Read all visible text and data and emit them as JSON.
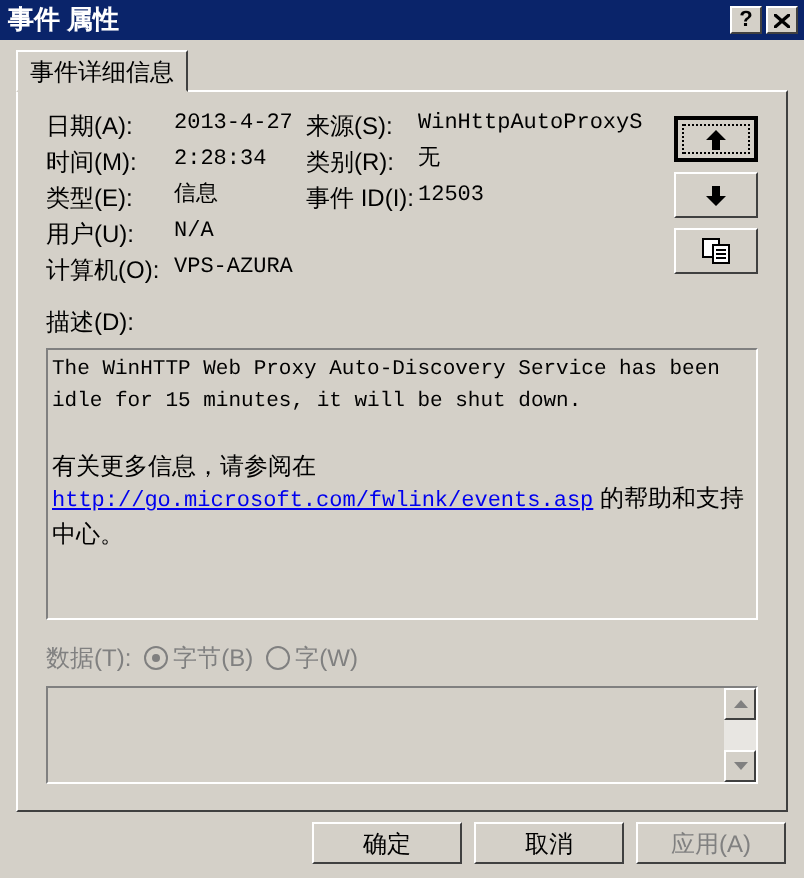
{
  "window": {
    "title": "事件 属性",
    "help_button": "?"
  },
  "tabs": [
    {
      "label": "事件详细信息",
      "selected": true
    }
  ],
  "fields": [
    [
      {
        "label": "日期(A):",
        "value": "2013-4-27"
      },
      {
        "label": "来源(S):",
        "value": "WinHttpAutoProxyS"
      }
    ],
    [
      {
        "label": "时间(M):",
        "value": "2:28:34"
      },
      {
        "label": "类别(R):",
        "value": "无"
      }
    ],
    [
      {
        "label": "类型(E):",
        "value": "信息"
      },
      {
        "label": "事件 ID(I):",
        "value": "12503"
      }
    ],
    [
      {
        "label": "用户(U):",
        "value": "N/A"
      }
    ],
    [
      {
        "label": "计算机(O):",
        "value": "VPS-AZURA"
      }
    ]
  ],
  "nav_buttons": [
    {
      "kind": "up",
      "focused": true
    },
    {
      "kind": "down",
      "focused": false
    },
    {
      "kind": "copy",
      "focused": false
    }
  ],
  "description": {
    "label": "描述(D):",
    "text": "The WinHTTP Web Proxy Auto-Discovery Service has been idle for 15 minutes, it will be shut down.",
    "more_info": "有关更多信息，请参阅在",
    "link": "http://go.microsoft.com/fwlink/events.asp",
    "link_suffix": "的帮助和支持中心。"
  },
  "data": {
    "label": "数据(T):",
    "disabled": true,
    "options": [
      {
        "label": "字节(B)",
        "selected": true
      },
      {
        "label": "字(W)",
        "selected": false
      }
    ]
  },
  "buttons": [
    {
      "label": "确定",
      "disabled": false
    },
    {
      "label": "取消",
      "disabled": false
    },
    {
      "label": "应用(A)",
      "disabled": true
    }
  ]
}
